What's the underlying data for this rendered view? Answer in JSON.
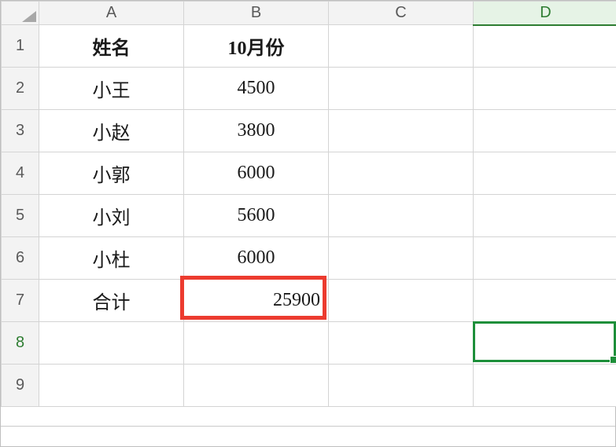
{
  "columns": [
    "A",
    "B",
    "C",
    "D"
  ],
  "rowNumbers": [
    "1",
    "2",
    "3",
    "4",
    "5",
    "6",
    "7",
    "8",
    "9"
  ],
  "header": {
    "A": "姓名",
    "B": "10月份"
  },
  "rows": [
    {
      "name": "小王",
      "value": "4500"
    },
    {
      "name": "小赵",
      "value": "3800"
    },
    {
      "name": "小郭",
      "value": "6000"
    },
    {
      "name": "小刘",
      "value": "5600"
    },
    {
      "name": "小杜",
      "value": "6000"
    }
  ],
  "totalRow": {
    "label": "合计",
    "value": "25900"
  },
  "selection": {
    "activeCell": "D8",
    "highlightedCell": "B7"
  },
  "chart_data": {
    "type": "table",
    "title": "10月份",
    "categories": [
      "小王",
      "小赵",
      "小郭",
      "小刘",
      "小杜",
      "合计"
    ],
    "values": [
      4500,
      3800,
      6000,
      5600,
      6000,
      25900
    ],
    "xlabel": "姓名",
    "ylabel": "10月份"
  }
}
